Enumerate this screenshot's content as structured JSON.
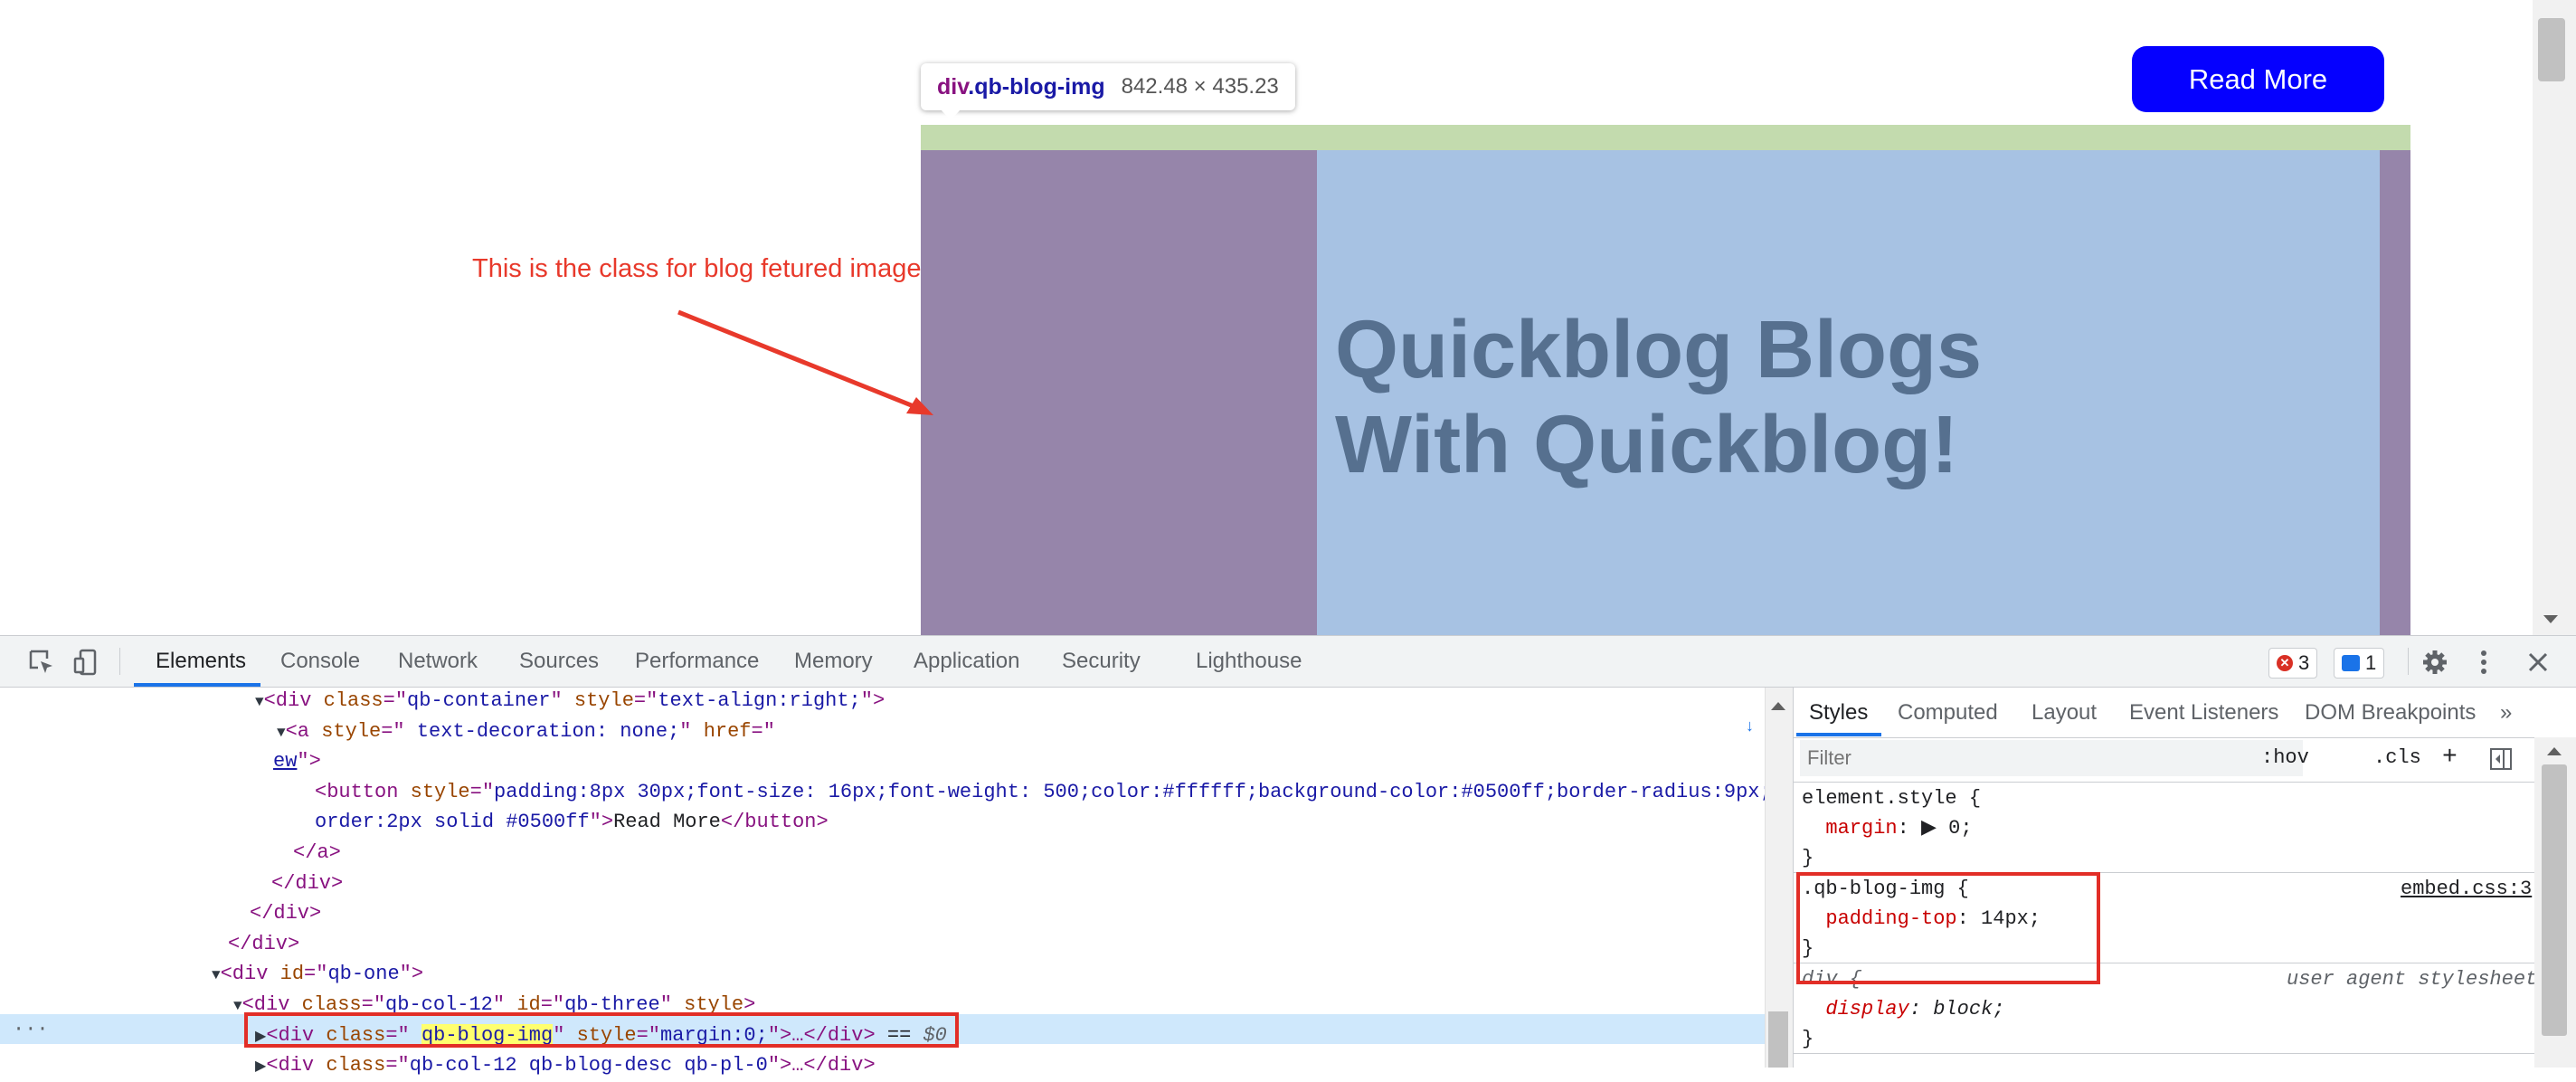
{
  "page": {
    "read_more_button": "Read More",
    "tooltip": {
      "tag": "div",
      "class": ".qb-blog-img",
      "dimensions": "842.48 × 435.23"
    },
    "image_headline": "Quickblog Blogs\nWith Quickblog!",
    "annotation": "This is the class for blog fetured image",
    "colors": {
      "margin": "#9685aa",
      "padding": "#c3dbae",
      "content": "#a7c2e3",
      "button": "#0500ff",
      "annotation": "#e8392b"
    }
  },
  "devtools": {
    "toolbar": {
      "icons": [
        "inspect-element-icon",
        "device-toolbar-icon"
      ],
      "tabs": [
        "Elements",
        "Console",
        "Network",
        "Sources",
        "Performance",
        "Memory",
        "Application",
        "Security",
        "Lighthouse"
      ],
      "active_tab": "Elements",
      "error_count": "3",
      "message_count": "1"
    },
    "elements": {
      "lines": [
        {
          "indent": 0,
          "prefix": "▼",
          "parts": [
            [
              "tag",
              "<div "
            ],
            [
              "an",
              "class"
            ],
            [
              "tag",
              "=\""
            ],
            [
              "av",
              "qb-container"
            ],
            [
              "tag",
              "\" "
            ],
            [
              "an",
              "style"
            ],
            [
              "tag",
              "=\""
            ],
            [
              "av",
              "text-align:right;"
            ],
            [
              "tag",
              "\">"
            ]
          ]
        },
        {
          "indent": 1,
          "prefix": "▼",
          "parts": [
            [
              "tag",
              "<a "
            ],
            [
              "an",
              "style"
            ],
            [
              "tag",
              "=\""
            ],
            [
              "av",
              " text-decoration: none;"
            ],
            [
              "tag",
              "\" "
            ],
            [
              "an",
              "href"
            ],
            [
              "tag",
              "=\""
            ]
          ]
        },
        {
          "indent": 0,
          "prefix": "",
          "parts": [
            [
              "link",
              "ew"
            ],
            [
              "tag",
              "\">"
            ]
          ]
        },
        {
          "indent": 2,
          "prefix": "",
          "parts": [
            [
              "tag",
              "<button "
            ],
            [
              "an",
              "style"
            ],
            [
              "tag",
              "=\""
            ],
            [
              "av",
              "padding:8px 30px;font-size: 16px;font-weight: 500;color:#ffffff;background-color:#0500ff;border-radius:9px;b"
            ]
          ]
        },
        {
          "indent": 2,
          "prefix": "",
          "parts": [
            [
              "av",
              "order:2px solid #0500ff"
            ],
            [
              "tag",
              "\">"
            ],
            [
              "txt",
              "Read More"
            ],
            [
              "tag",
              "</button>"
            ]
          ]
        },
        {
          "indent": 1,
          "prefix": "",
          "parts": [
            [
              "tag",
              "</a>"
            ]
          ]
        },
        {
          "indent": 0,
          "prefix": "",
          "parts": [
            [
              "tag",
              "</div>"
            ]
          ]
        },
        {
          "indent": -1,
          "prefix": "",
          "parts": [
            [
              "tag",
              "</div>"
            ]
          ]
        },
        {
          "indent": -2,
          "prefix": "",
          "parts": [
            [
              "tag",
              "</div>"
            ]
          ]
        },
        {
          "indent": -2,
          "prefix": "▼",
          "parts": [
            [
              "tag",
              "<div "
            ],
            [
              "an",
              "id"
            ],
            [
              "tag",
              "=\""
            ],
            [
              "av",
              "qb-one"
            ],
            [
              "tag",
              "\">"
            ]
          ]
        },
        {
          "indent": -1,
          "prefix": "▼",
          "parts": [
            [
              "tag",
              "<div "
            ],
            [
              "an",
              "class"
            ],
            [
              "tag",
              "=\""
            ],
            [
              "av",
              "qb-col-12"
            ],
            [
              "tag",
              "\" "
            ],
            [
              "an",
              "id"
            ],
            [
              "tag",
              "=\""
            ],
            [
              "av",
              "qb-three"
            ],
            [
              "tag",
              "\" "
            ],
            [
              "an",
              "style"
            ],
            [
              "tag",
              ">"
            ]
          ]
        },
        {
          "indent": 0,
          "prefix": "▶",
          "parts": [
            [
              "tag",
              "<div "
            ],
            [
              "an",
              "class"
            ],
            [
              "tag",
              "=\" "
            ],
            [
              "hl",
              "qb-blog-img"
            ],
            [
              "tag",
              "\" "
            ],
            [
              "an",
              "style"
            ],
            [
              "tag",
              "=\""
            ],
            [
              "av",
              "margin:0;"
            ],
            [
              "tag",
              "\">…</div>"
            ],
            [
              "txt",
              " == "
            ],
            [
              "ital",
              "$0"
            ]
          ]
        },
        {
          "indent": 0,
          "prefix": "▶",
          "parts": [
            [
              "tag",
              "<div "
            ],
            [
              "an",
              "class"
            ],
            [
              "tag",
              "=\""
            ],
            [
              "av",
              "qb-col-12 qb-blog-desc qb-pl-0"
            ],
            [
              "tag",
              "\">…</div>"
            ]
          ]
        }
      ]
    },
    "styles": {
      "sub_tabs": [
        "Styles",
        "Computed",
        "Layout",
        "Event Listeners",
        "DOM Breakpoints"
      ],
      "active_sub_tab": "Styles",
      "more_tabs": "»",
      "filter_placeholder": "Filter",
      "hov": ":hov",
      "cls": ".cls",
      "plus": "+",
      "rules": {
        "element_style_selector": "element.style {",
        "element_style_prop": "margin",
        "element_style_value": ": ▶ 0;",
        "qb_selector": ".qb-blog-img {",
        "qb_source": "embed.css:3",
        "qb_prop": "padding-top",
        "qb_value": ": 14px;",
        "div_selector": "div {",
        "div_source": "user agent stylesheet",
        "div_prop": "display",
        "div_value": ": block;",
        "close_brace": "}"
      }
    }
  }
}
